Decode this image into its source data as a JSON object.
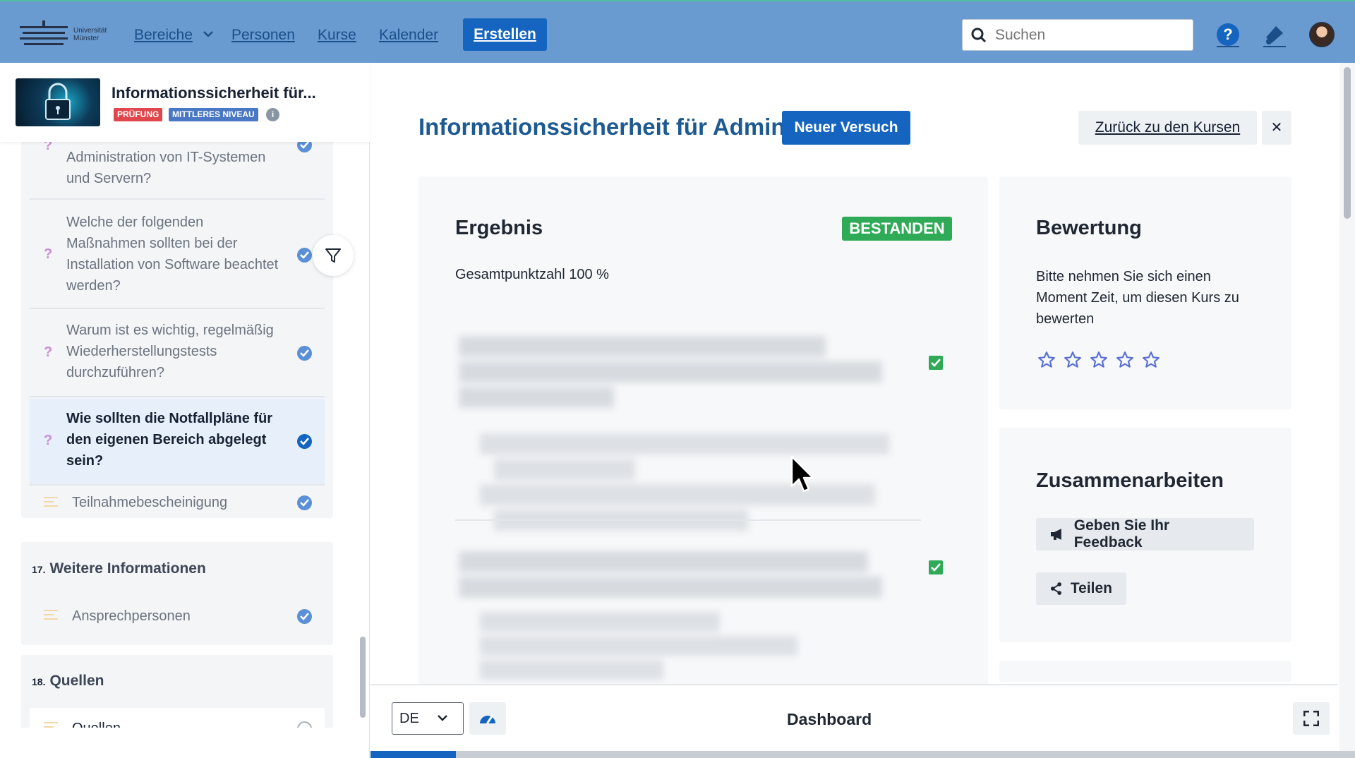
{
  "colors": {
    "nav_bg": "#6a9bd0",
    "primary": "#1565c0",
    "success": "#2faa57",
    "badge_exam": "#e0474c",
    "badge_level": "#4a78c4"
  },
  "logo": {
    "line1": "Universität",
    "line2": "Münster"
  },
  "nav": {
    "items": [
      "Bereiche",
      "Personen",
      "Kurse",
      "Kalender"
    ],
    "create_label": "Erstellen",
    "search_placeholder": "Suchen",
    "icons": [
      "help-icon",
      "notification-icon",
      "avatar"
    ]
  },
  "sidebar": {
    "course_title": "Informationssicherheit für...",
    "badges": [
      "PRÜFUNG",
      "MITTLERES NIVEAU"
    ],
    "info_icon": "info-icon",
    "items": [
      {
        "text": "Administration von IT-Systemen und Servern?",
        "type": "question",
        "status": "done"
      },
      {
        "text": "Welche der folgenden Maßnahmen sollten bei der Installation von Software beachtet werden?",
        "type": "question",
        "status": "done"
      },
      {
        "text": "Warum ist es wichtig, regelmäßig Wiederherstellungstests durchzuführen?",
        "type": "question",
        "status": "done"
      },
      {
        "text": "Wie sollten die Notfallpläne für den eigenen Bereich abgelegt sein?",
        "type": "question",
        "status": "done",
        "active": true
      },
      {
        "text": "Teilnahmebescheinigung",
        "type": "text",
        "status": "done"
      }
    ],
    "groups": [
      {
        "number": "17.",
        "title": "Weitere Informationen",
        "items": [
          {
            "text": "Ansprechpersonen",
            "status": "done"
          }
        ]
      },
      {
        "number": "18.",
        "title": "Quellen",
        "items": [
          {
            "text": "Quellen",
            "status": "open"
          }
        ]
      }
    ]
  },
  "main": {
    "title": "Informationssicherheit für Admins",
    "new_attempt": "Neuer Versuch",
    "back": "Zurück zu den Kursen",
    "close": "✕",
    "result": {
      "title": "Ergebnis",
      "status": "BESTANDEN",
      "score_label": "Gesamtpunktzahl",
      "score_value": "100 %"
    },
    "rating": {
      "title": "Bewertung",
      "text": "Bitte nehmen Sie sich einen Moment Zeit, um diesen Kurs zu bewerten",
      "stars": 5,
      "selected": 0
    },
    "collab": {
      "title": "Zusammenarbeiten",
      "feedback": "Geben Sie Ihr Feedback",
      "share": "Teilen"
    }
  },
  "bottom": {
    "language": "DE",
    "dashboard": "Dashboard",
    "progress": 0.087
  }
}
